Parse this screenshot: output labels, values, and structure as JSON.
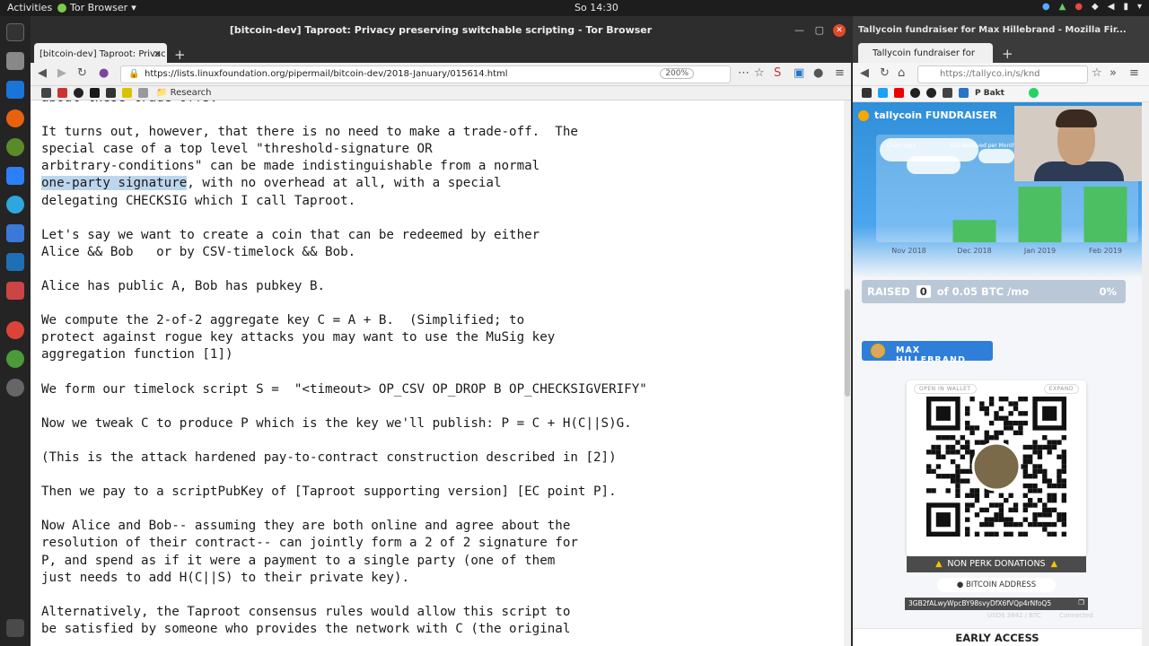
{
  "topbar": {
    "activities": "Activities",
    "app_menu": "Tor Browser",
    "clock": "So 14:30"
  },
  "tor_browser": {
    "window_title": "[bitcoin-dev] Taproot: Privacy preserving switchable scripting - Tor Browser",
    "tab_label": "[bitcoin-dev] Taproot: Privac",
    "url": "https://lists.linuxfoundation.org/pipermail/bitcoin-dev/2018-January/015614.html",
    "zoom": "200%",
    "bookmark_folder": "Research",
    "email_lines": [
      "about these trade-offs.",
      "",
      "It turns out, however, that there is no need to make a trade-off.  The",
      "special case of a top level \"threshold-signature OR",
      "arbitrary-conditions\" can be made indistinguishable from a normal",
      "__HL__",
      "delegating CHECKSIG which I call Taproot.",
      "",
      "Let's say we want to create a coin that can be redeemed by either",
      "Alice && Bob   or by CSV-timelock && Bob.",
      "",
      "Alice has public A, Bob has pubkey B.",
      "",
      "We compute the 2-of-2 aggregate key C = A + B.  (Simplified; to",
      "protect against rogue key attacks you may want to use the MuSig key",
      "aggregation function [1])",
      "",
      "We form our timelock script S =  \"<timeout> OP_CSV OP_DROP B OP_CHECKSIGVERIFY\"",
      "",
      "Now we tweak C to produce P which is the key we'll publish: P = C + H(C||S)G.",
      "",
      "(This is the attack hardened pay-to-contract construction described in [2])",
      "",
      "Then we pay to a scriptPubKey of [Taproot supporting version] [EC point P].",
      "",
      "Now Alice and Bob-- assuming they are both online and agree about the",
      "resolution of their contract-- can jointly form a 2 of 2 signature for",
      "P, and spend as if it were a payment to a single party (one of them",
      "just needs to add H(C||S) to their private key).",
      "",
      "Alternatively, the Taproot consensus rules would allow this script to",
      "be satisfied by someone who provides the network with C (the original"
    ],
    "highlight_text": "one-party signature",
    "highlight_rest": ", with no overhead at all, with a special"
  },
  "firefox": {
    "window_title": "Tallycoin fundraiser for Max Hillebrand - Mozilla Fir...",
    "tab_label": "Tallycoin fundraiser for",
    "url": "https://tallyco.in/s/knd",
    "bookmark_label": "P Bakt"
  },
  "tallycoin": {
    "brand": "tallycoin FUNDRAISER",
    "raised_label": "RAISED",
    "raised_value": "0",
    "raised_goal": "of 0.05 BTC /mo",
    "raised_pct": "0%",
    "owner_name": "MAX HILLEBRAND",
    "open_wallet": "OPEN IN WALLET",
    "expand": "EXPAND",
    "non_perk": "NON PERK DONATIONS",
    "bitcoin_address_label": "BITCOIN ADDRESS",
    "address": "3GB2fALwyWpcBY98svyDfX6fVQp4rNfoQ5",
    "usd_line": "USD$ 3842 / BTC",
    "connected": "Connected",
    "early_access": "EARLY ACCESS"
  },
  "chart_data": {
    "type": "bar",
    "categories": [
      "Nov 2018",
      "Dec 2018",
      "Jan 2019",
      "Feb 2019"
    ],
    "values": [
      0,
      0.4,
      1,
      1
    ],
    "legend": [
      "Chart Type",
      "BTC Received per Month"
    ],
    "colors": {
      "bar": "#4cbf63"
    }
  }
}
